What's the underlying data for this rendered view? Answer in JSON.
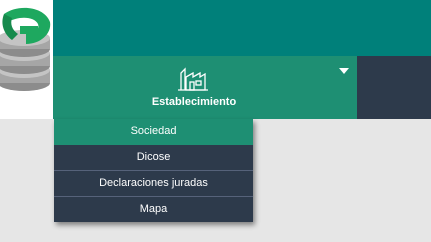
{
  "nav": {
    "active_item": {
      "label": "Establecimiento",
      "icon": "building-icon",
      "caret_icon": "caret-down-icon"
    }
  },
  "dropdown": {
    "items": [
      {
        "label": "Sociedad",
        "selected": true
      },
      {
        "label": "Dicose",
        "selected": false
      },
      {
        "label": "Declaraciones juradas",
        "selected": false
      },
      {
        "label": "Mapa",
        "selected": false
      }
    ]
  },
  "colors": {
    "header_teal": "#00807a",
    "nav_green": "#1e8f73",
    "nav_dark": "#2d3a4b",
    "page_bg": "#e6e6e6"
  }
}
